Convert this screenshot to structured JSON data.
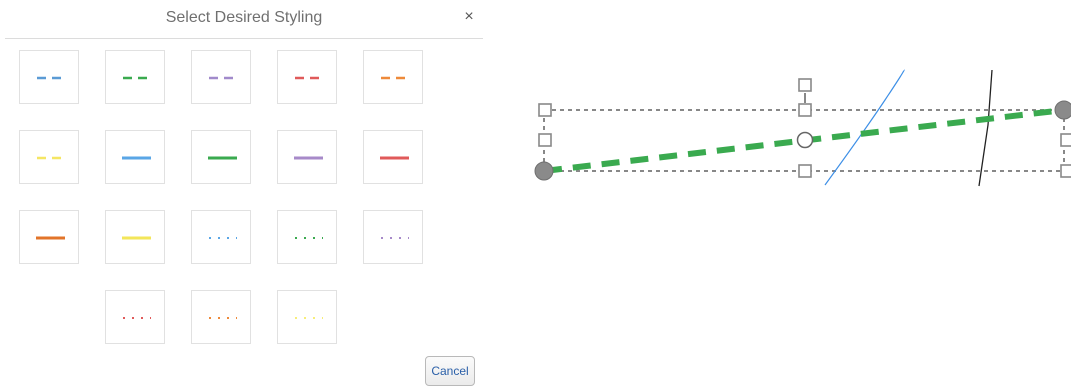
{
  "dialog": {
    "title": "Select Desired Styling",
    "close_label": "×",
    "cancel_label": "Cancel"
  },
  "swatches": [
    {
      "name": "blue-dashed",
      "pattern": "dashed",
      "color": "#5b9bd5"
    },
    {
      "name": "green-dashed",
      "pattern": "dashed",
      "color": "#3aaa4f"
    },
    {
      "name": "purple-dashed",
      "pattern": "dashed",
      "color": "#a18acb"
    },
    {
      "name": "red-dashed",
      "pattern": "dashed",
      "color": "#e05a5a"
    },
    {
      "name": "orange-dashed",
      "pattern": "dashed",
      "color": "#ee8a3a"
    },
    {
      "name": "yellow-dashed",
      "pattern": "dashed",
      "color": "#f5e663"
    },
    {
      "name": "blue-solid",
      "pattern": "solid",
      "color": "#5aa6e6"
    },
    {
      "name": "green-solid",
      "pattern": "solid",
      "color": "#3aaa4f"
    },
    {
      "name": "purple-solid",
      "pattern": "solid",
      "color": "#a78ac9"
    },
    {
      "name": "red-solid",
      "pattern": "solid",
      "color": "#e05a5a"
    },
    {
      "name": "orange-solid",
      "pattern": "solid",
      "color": "#e2742a"
    },
    {
      "name": "yellow-solid",
      "pattern": "solid",
      "color": "#f3e65a"
    },
    {
      "name": "blue-dotted",
      "pattern": "dotted",
      "color": "#5aa6e6"
    },
    {
      "name": "green-dotted",
      "pattern": "dotted",
      "color": "#3aaa4f"
    },
    {
      "name": "purple-dotted",
      "pattern": "dotted",
      "color": "#a78ac9"
    },
    {
      "name": "red-dotted",
      "pattern": "dotted",
      "color": "#e05a5a"
    },
    {
      "name": "orange-dotted",
      "pattern": "dotted",
      "color": "#ee8a3a"
    },
    {
      "name": "yellow-dotted",
      "pattern": "dotted",
      "color": "#f7ee7a"
    }
  ],
  "canvas": {
    "selected_line_color": "#3aaa4f",
    "selection_box_color": "#888888",
    "handle_color": "#8a8a8a",
    "blue_stroke_color": "#3d8fe6",
    "black_stroke_color": "#222222"
  }
}
